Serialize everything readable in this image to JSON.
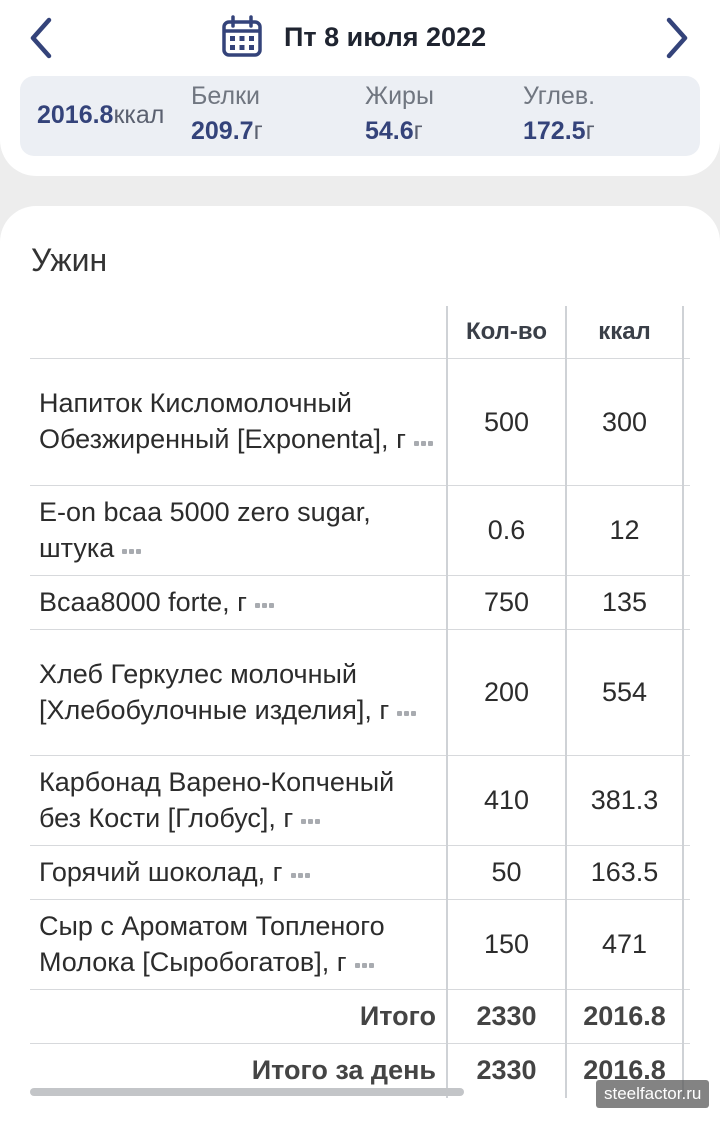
{
  "header": {
    "date": "Пт 8 июля 2022",
    "prev_icon": "chevron-left-icon",
    "next_icon": "chevron-right-icon",
    "calendar_icon": "calendar-icon",
    "accent_color": "#34437a"
  },
  "summary": {
    "kcal_value": "2016.8",
    "kcal_unit": "ккал",
    "protein_label": "Белки",
    "protein_value": "209.7",
    "protein_unit": "г",
    "fat_label": "Жиры",
    "fat_value": "54.6",
    "fat_unit": "г",
    "carbs_label": "Углев.",
    "carbs_value": "172.5",
    "carbs_unit": "г"
  },
  "meal": {
    "title": "Ужин",
    "columns": {
      "qty": "Кол-во",
      "kcal": "ккал"
    },
    "rows": [
      {
        "name": "Напиток Кисломолочный Обезжиренный [Exponenta], г",
        "qty": "500",
        "kcal": "300"
      },
      {
        "name": "E-on bcaa 5000 zero sugar, штука",
        "qty": "0.6",
        "kcal": "12"
      },
      {
        "name": "Bcaa8000 forte, г",
        "qty": "750",
        "kcal": "135"
      },
      {
        "name": "Хлеб Геркулес молочный [Хлебобулочные изделия], г",
        "qty": "200",
        "kcal": "554"
      },
      {
        "name": "Карбонад Варено-Копченый без Кости [Глобус], г",
        "qty": "410",
        "kcal": "381.3"
      },
      {
        "name": "Горячий шоколад, г",
        "qty": "50",
        "kcal": "163.5"
      },
      {
        "name": "Сыр с Ароматом Топленого Молока [Сыробогатов], г",
        "qty": "150",
        "kcal": "471"
      }
    ],
    "total_label": "Итого",
    "total_qty": "2330",
    "total_kcal": "2016.8",
    "day_total_label": "Итого за день",
    "day_total_qty": "2330",
    "day_total_kcal": "2016.8"
  },
  "watermark": "steelfactor.ru"
}
